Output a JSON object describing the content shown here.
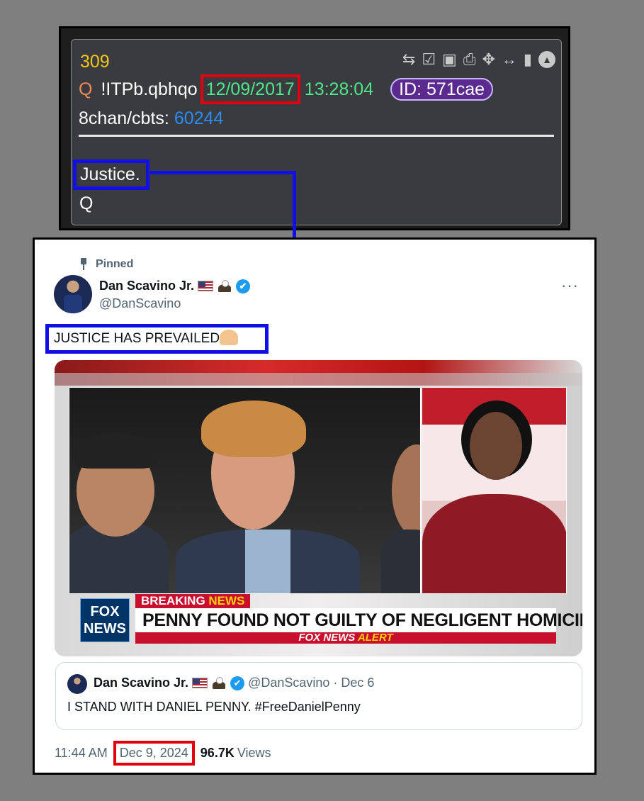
{
  "qpost": {
    "number": "309",
    "sig": "Q",
    "tripcode": "!ITPb.qbhqo",
    "date": "12/09/2017",
    "time": "13:28:04",
    "id": "ID: 571cae",
    "board": "8chan/cbts:",
    "post_no": "60244",
    "body": "Justice.",
    "signoff": "Q",
    "tool_icons": [
      "share-icon",
      "clipboard-check-icon",
      "vr-goggles-icon",
      "document-icon",
      "move-icon",
      "resize-icon",
      "clipboard-icon",
      "collapse-icon"
    ]
  },
  "tweet": {
    "pinned_label": "Pinned",
    "author_name": "Dan Scavino Jr.",
    "handle": "@DanScavino",
    "more": "···",
    "text": "JUSTICE HAS PREVAILED",
    "media": {
      "breaking_1": "BREAKING ",
      "breaking_2": "NEWS",
      "fox_logo_1": "FOX",
      "fox_logo_2": "NEWS",
      "headline": "PENNY FOUND NOT GUILTY OF NEGLIGENT HOMICIDE",
      "alert_1": "FOX NEWS ",
      "alert_2": "ALERT"
    },
    "quote": {
      "author_name": "Dan Scavino Jr.",
      "meta": "@DanScavino · Dec 6",
      "text": "I STAND WITH DANIEL PENNY. #FreeDanielPenny"
    },
    "footer": {
      "time": "11:44 AM",
      "date": "Dec 9, 2024",
      "views_count": "96.7K",
      "views_label": "Views"
    }
  },
  "colors": {
    "highlight_red": "#e1000e",
    "highlight_blue": "#1010e6",
    "q_green": "#4ee78a",
    "q_link": "#2b8cff",
    "verified": "#1d9bf0"
  }
}
